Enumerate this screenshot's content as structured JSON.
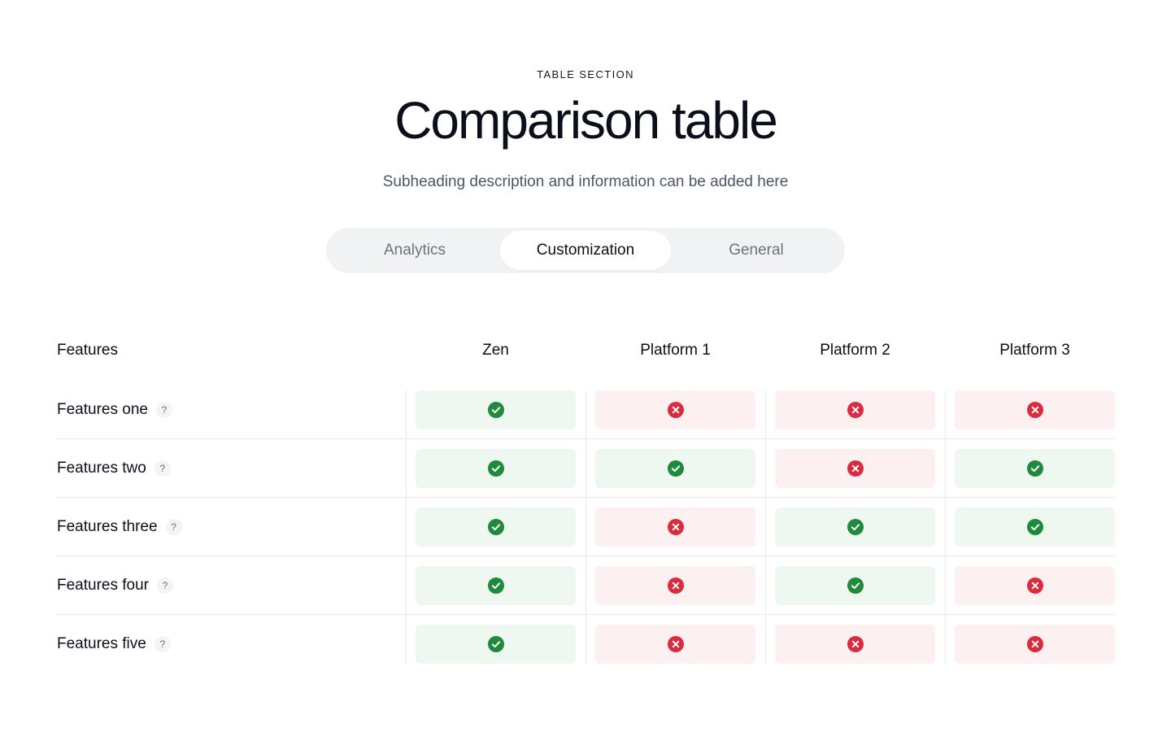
{
  "header": {
    "eyebrow": "TABLE SECTION",
    "title": "Comparison table",
    "subtitle": "Subheading description and information can be added here"
  },
  "tabs": [
    {
      "label": "Analytics",
      "active": false
    },
    {
      "label": "Customization",
      "active": true
    },
    {
      "label": "General",
      "active": false
    }
  ],
  "table": {
    "feature_header": "Features",
    "columns": [
      "Zen",
      "Platform 1",
      "Platform 2",
      "Platform 3"
    ],
    "rows": [
      {
        "label": "Features one",
        "help": "?",
        "values": [
          true,
          false,
          false,
          false
        ]
      },
      {
        "label": "Features two",
        "help": "?",
        "values": [
          true,
          true,
          false,
          true
        ]
      },
      {
        "label": "Features three",
        "help": "?",
        "values": [
          true,
          false,
          true,
          true
        ]
      },
      {
        "label": "Features four",
        "help": "?",
        "values": [
          true,
          false,
          true,
          false
        ]
      },
      {
        "label": "Features five",
        "help": "?",
        "values": [
          true,
          false,
          false,
          false
        ]
      }
    ]
  },
  "icons": {
    "yes": "check-circle-icon",
    "no": "x-circle-icon"
  },
  "colors": {
    "yes": "#1f8a3b",
    "no": "#d92d3f",
    "yes_bg": "#eef8f0",
    "no_bg": "#fdf0f1"
  }
}
